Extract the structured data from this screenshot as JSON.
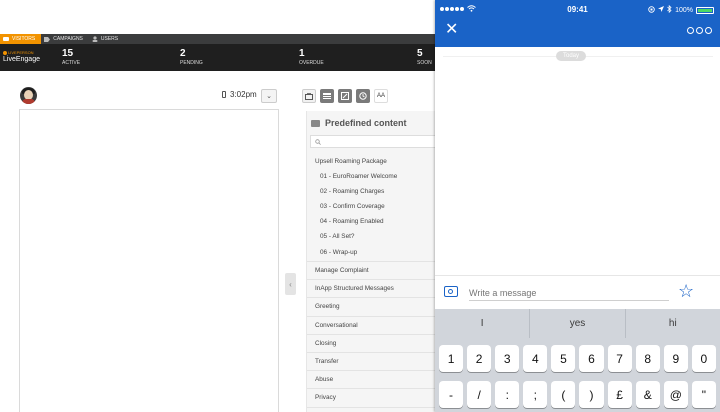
{
  "nav": {
    "tabs": [
      {
        "label": "VISITORS",
        "icon": "chat-icon"
      },
      {
        "label": "CAMPAIGNS",
        "icon": "tag-icon"
      },
      {
        "label": "USERS",
        "icon": "user-icon"
      }
    ]
  },
  "brand": {
    "small": "LIVEPERSON",
    "name": "LiveEngage"
  },
  "stats": [
    {
      "value": "15",
      "label": "ACTIVE"
    },
    {
      "value": "2",
      "label": "PENDING"
    },
    {
      "value": "1",
      "label": "OVERDUE"
    },
    {
      "value": "5",
      "label": "SOON"
    }
  ],
  "conversation": {
    "time": "3:02pm",
    "dropdown_icon": "chevron-down-icon"
  },
  "toolbar": {
    "aa_label": "AA"
  },
  "predefined": {
    "title": "Predefined content",
    "search_icon": "search-icon",
    "items": [
      {
        "label": "Upsell Roaming Package",
        "kind": "category"
      },
      {
        "label": "01 - EuroRoamer Welcome",
        "kind": "sub"
      },
      {
        "label": "02 - Roaming Charges",
        "kind": "sub"
      },
      {
        "label": "03 - Confirm Coverage",
        "kind": "sub"
      },
      {
        "label": "04 - Roaming Enabled",
        "kind": "sub"
      },
      {
        "label": "05 - All Set?",
        "kind": "sub"
      },
      {
        "label": "06 - Wrap-up",
        "kind": "sub"
      },
      {
        "label": "Manage Complaint",
        "kind": "category"
      },
      {
        "label": "InApp Structured Messages",
        "kind": "category"
      },
      {
        "label": "Greeting",
        "kind": "category"
      },
      {
        "label": "Conversational",
        "kind": "category"
      },
      {
        "label": "Closing",
        "kind": "category"
      },
      {
        "label": "Transfer",
        "kind": "category"
      },
      {
        "label": "Abuse",
        "kind": "category"
      },
      {
        "label": "Privacy",
        "kind": "category"
      }
    ]
  },
  "phone": {
    "status": {
      "time": "09:41",
      "battery": "100%"
    },
    "date_chip": "Today",
    "message_placeholder": "Write a message",
    "suggestions": [
      "I",
      "yes",
      "hi"
    ],
    "keys_row1": [
      "1",
      "2",
      "3",
      "4",
      "5",
      "6",
      "7",
      "8",
      "9",
      "0"
    ],
    "keys_row2": [
      "-",
      "/",
      ":",
      ";",
      "(",
      ")",
      "£",
      "&",
      "@",
      "\""
    ],
    "accent_color": "#1a63c7"
  }
}
